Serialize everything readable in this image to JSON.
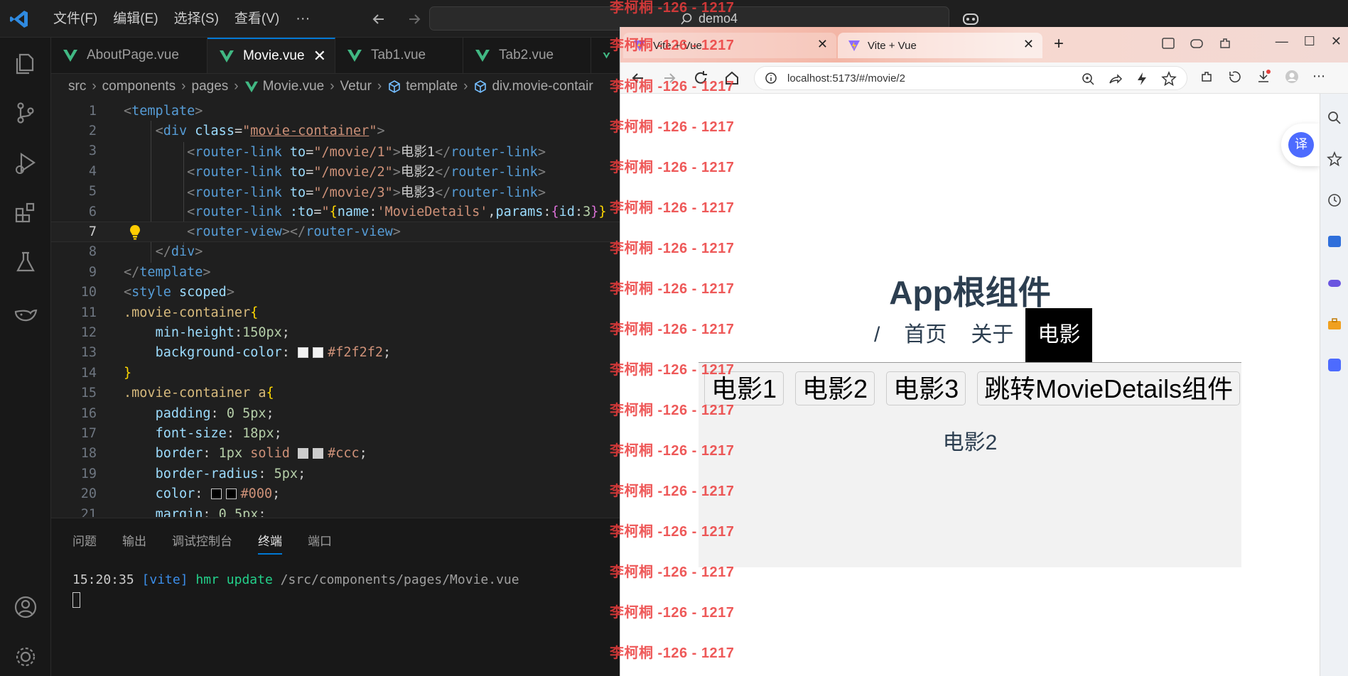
{
  "vscode": {
    "menu": [
      "文件(F)",
      "编辑(E)",
      "选择(S)",
      "查看(V)"
    ],
    "menu_more": "···",
    "search_text": "demo4",
    "tabs": [
      {
        "label": "AboutPage.vue",
        "active": false
      },
      {
        "label": "Movie.vue",
        "active": true
      },
      {
        "label": "Tab1.vue",
        "active": false
      },
      {
        "label": "Tab2.vue",
        "active": false
      }
    ],
    "tab_close": "✕",
    "breadcrumb": [
      "src",
      "components",
      "pages",
      "Movie.vue",
      "Vetur",
      "template",
      "div.movie-contair"
    ],
    "line_numbers": [
      "1",
      "2",
      "3",
      "4",
      "5",
      "6",
      "7",
      "8",
      "9",
      "10",
      "11",
      "12",
      "13",
      "14",
      "15",
      "16",
      "17",
      "18",
      "19",
      "20",
      "21"
    ],
    "panel_tabs": [
      "问题",
      "输出",
      "调试控制台",
      "终端",
      "端口"
    ],
    "active_panel_tab": "终端",
    "terminal": {
      "time": "15:20:35",
      "tag": "[vite]",
      "action": "hmr update",
      "path": "/src/components/pages/Movie.vue"
    }
  },
  "browser": {
    "tabs": [
      {
        "title": "Vite + Vue"
      },
      {
        "title": "Vite + Vue"
      }
    ],
    "tab_close": "✕",
    "new_tab": "+",
    "url": "localhost:5173/#/movie/2",
    "translate_label": "译",
    "page": {
      "title": "App根组件",
      "nav": [
        {
          "label": "/",
          "active": false
        },
        {
          "label": "首页",
          "active": false
        },
        {
          "label": "关于",
          "active": false
        },
        {
          "label": "电影",
          "active": true
        }
      ],
      "movie_links": [
        "电影1",
        "电影2",
        "电影3",
        "跳转MovieDetails组件"
      ],
      "movie_detail": "电影2"
    }
  },
  "watermark": "李柯桐 -126 - 1217",
  "colors": {
    "vscode_bg": "#1f1f1f",
    "accent": "#0078d4",
    "watermark": "#eb3c3c",
    "nav_active_bg": "#000000",
    "movie_container_bg": "#f2f2f2"
  }
}
